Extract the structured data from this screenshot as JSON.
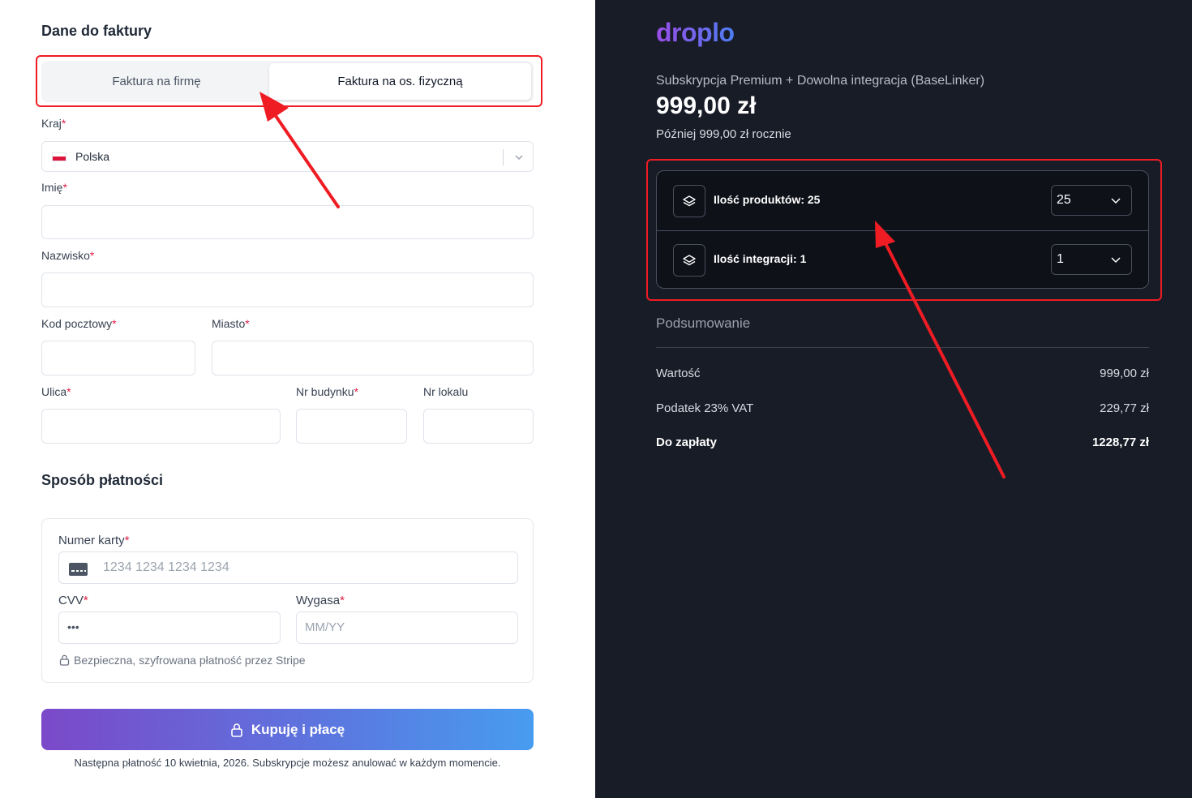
{
  "billing": {
    "title": "Dane do faktury",
    "tab_company": "Faktura na firmę",
    "tab_person": "Faktura na os. fizyczną",
    "country_label": "Kraj",
    "country_value": "Polska",
    "first_name_label": "Imię",
    "last_name_label": "Nazwisko",
    "zip_label": "Kod pocztowy",
    "city_label": "Miasto",
    "street_label": "Ulica",
    "building_label": "Nr budynku",
    "apartment_label": "Nr lokalu",
    "required_mark": "*"
  },
  "payment": {
    "title": "Sposób płatności",
    "card_label": "Numer karty",
    "card_placeholder": "1234 1234 1234 1234",
    "cvv_label": "CVV",
    "cvv_value": "•••",
    "expiry_label": "Wygasa",
    "expiry_placeholder": "MM/YY",
    "secure_note": "Bezpieczna, szyfrowana płatność przez Stripe",
    "buy_label": "Kupuję i płacę",
    "footnote": "Następna płatność 10 kwietnia, 2026. Subskrypcje możesz anulować w każdym momencie."
  },
  "order": {
    "logo": "droplo",
    "plan": "Subskrypcja Premium + Dowolna integracja (BaseLinker)",
    "price": "999,00 zł",
    "later": "Później 999,00 zł rocznie",
    "options": [
      {
        "label": "Ilość produktów: 25",
        "value": "25"
      },
      {
        "label": "Ilość integracji: 1",
        "value": "1"
      }
    ],
    "summary_title": "Podsumowanie",
    "rows": [
      {
        "label": "Wartość",
        "value": "999,00 zł"
      },
      {
        "label": "Podatek 23% VAT",
        "value": "229,77 zł"
      },
      {
        "label": "Do zapłaty",
        "value": "1228,77 zł"
      }
    ]
  },
  "colors": {
    "annotation": "#ef1c24",
    "dark_panel": "#181c27",
    "button_gradient_start": "#7b49c9",
    "button_gradient_end": "#479cef"
  }
}
